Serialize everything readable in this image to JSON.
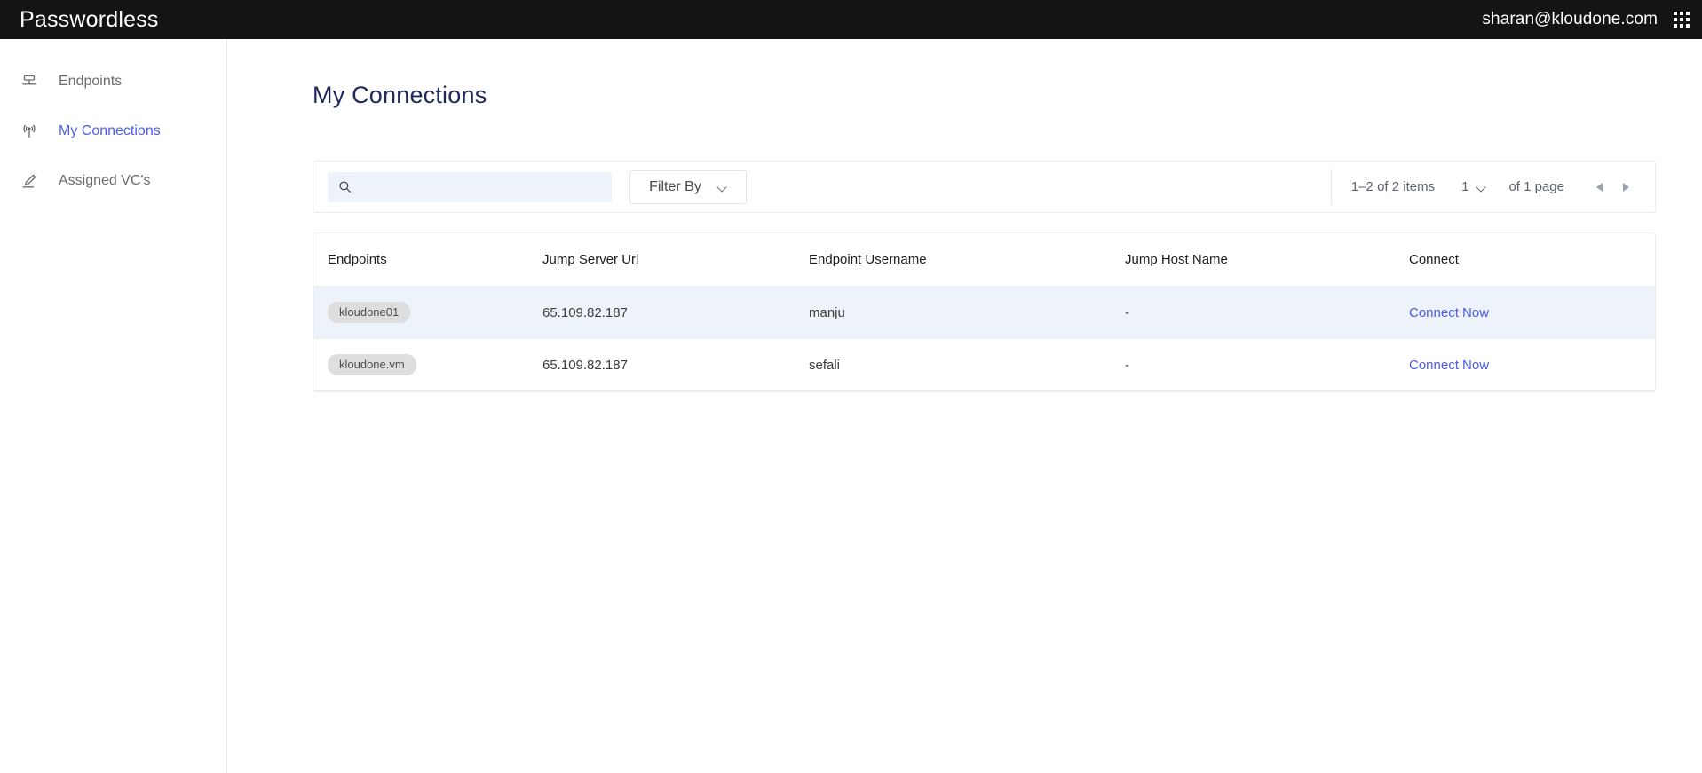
{
  "topbar": {
    "brand": "Passwordless",
    "user_email": "sharan@kloudone.com",
    "apps_icon": "grid-apps-icon",
    "background": "#141414"
  },
  "sidebar": {
    "items": [
      {
        "label": "Endpoints",
        "icon": "server-icon",
        "active": false
      },
      {
        "label": "My Connections",
        "icon": "antenna-broadcast-icon",
        "active": true
      },
      {
        "label": "Assigned VC's",
        "icon": "signature-pen-icon",
        "active": false
      }
    ],
    "active_color": "#4a5ce8"
  },
  "main": {
    "page_title": "My Connections",
    "toolbar": {
      "search": {
        "value": "",
        "placeholder": "",
        "icon": "search-icon"
      },
      "filter": {
        "label": "Filter By",
        "icon": "chevron-down-icon"
      },
      "pagination": {
        "items_range": "1–2 of 2 items",
        "current_page": "1",
        "page_total": "of 1 page",
        "prev_icon": "caret-left-icon",
        "next_icon": "caret-right-icon"
      }
    },
    "table": {
      "columns": [
        "Endpoints",
        "Jump Server Url",
        "Endpoint Username",
        "Jump Host Name",
        "Connect"
      ],
      "rows": [
        {
          "endpoint": "kloudone01",
          "jump_server_url": "65.109.82.187",
          "endpoint_username": "manju",
          "jump_host_name": "-",
          "connect_label": "Connect Now",
          "highlighted": true
        },
        {
          "endpoint": "kloudone.vm",
          "jump_server_url": "65.109.82.187",
          "endpoint_username": "sefali",
          "jump_host_name": "-",
          "connect_label": "Connect Now",
          "highlighted": false
        }
      ]
    }
  },
  "colors": {
    "accent": "#4a5ce8",
    "title": "#20295c",
    "row_highlight": "#eef2fb",
    "pill_bg": "#dedede"
  }
}
